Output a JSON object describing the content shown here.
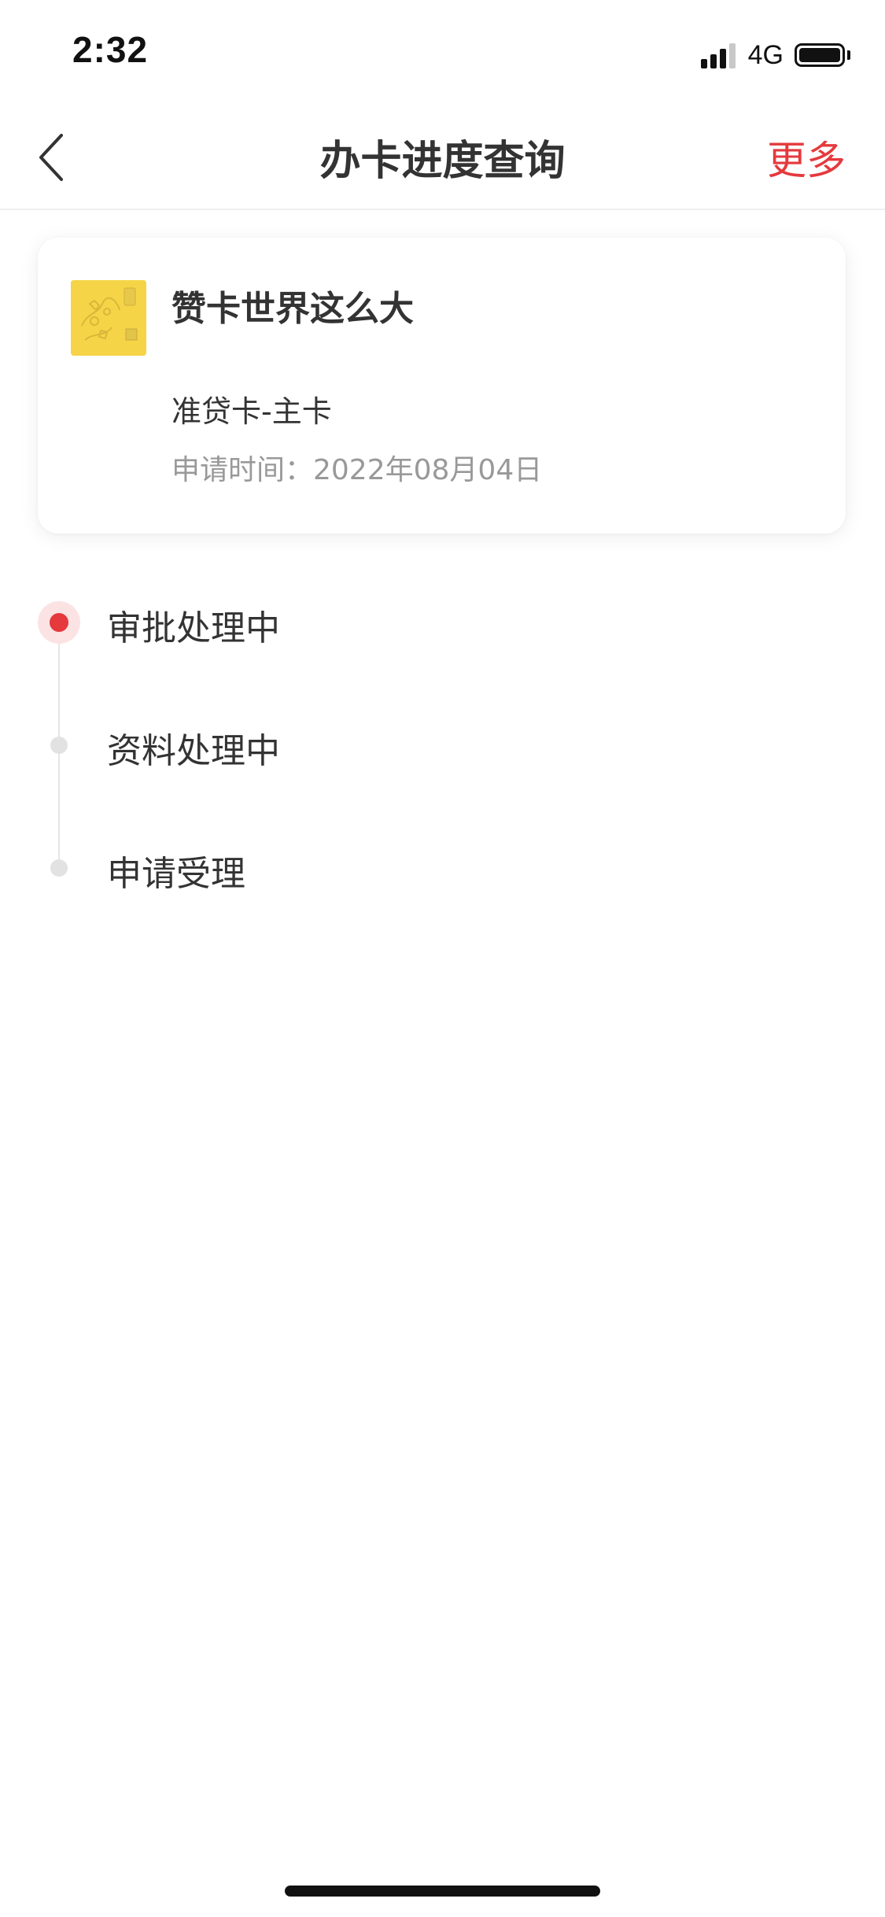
{
  "status_bar": {
    "time": "2:32",
    "network": "4G",
    "icons": [
      "signal-icon",
      "battery-icon"
    ]
  },
  "nav": {
    "title": "办卡进度查询",
    "more_label": "更多",
    "back_icon": "chevron-left-icon"
  },
  "card": {
    "name": "赞卡世界这么大",
    "type": "准贷卡-主卡",
    "apply_date": "申请时间：2022年08月04日"
  },
  "timeline": {
    "steps": [
      {
        "label": "审批处理中",
        "active": true
      },
      {
        "label": "资料处理中",
        "active": false
      },
      {
        "label": "申请受理",
        "active": false
      }
    ]
  },
  "colors": {
    "accent": "#e5393d",
    "text": "#333333",
    "muted": "#999999",
    "card_thumb": "#f5d547"
  }
}
